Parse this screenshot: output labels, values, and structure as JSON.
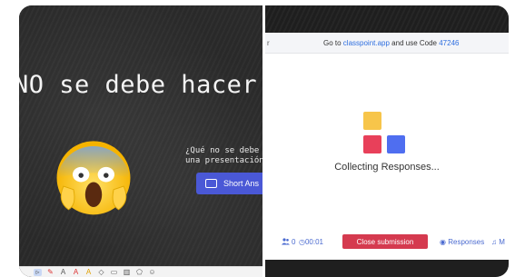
{
  "slide": {
    "title": "NO se debe hacer!",
    "question_lines": [
      "¿Qué no se debe h",
      "una presentación d"
    ],
    "short_answer_label": "Short Ans",
    "emoji": "screaming-face-emoji"
  },
  "toolbar": {
    "icons": [
      "pointer-icon",
      "laser-icon",
      "pen-icon",
      "highlighter-icon",
      "text-icon",
      "eraser-icon",
      "whiteboard-icon",
      "chart-icon",
      "shapes-icon",
      "more-icon"
    ]
  },
  "classpoint": {
    "codebar_edge": "r",
    "codebar_prefix": "Go to ",
    "codebar_site": "classpoint.app",
    "codebar_mid": " and use Code ",
    "codebar_code": "47246",
    "collecting_text": "Collecting Responses...",
    "participant_count": "0",
    "timer": "00:01",
    "close_button": "Close submission",
    "responses_label": "Responses",
    "music_label": "M",
    "colors": {
      "yellow": "#f7c54a",
      "red": "#e8405a",
      "blue": "#4f6ef0",
      "close": "#d53a4f",
      "link": "#2f6fe0"
    }
  }
}
